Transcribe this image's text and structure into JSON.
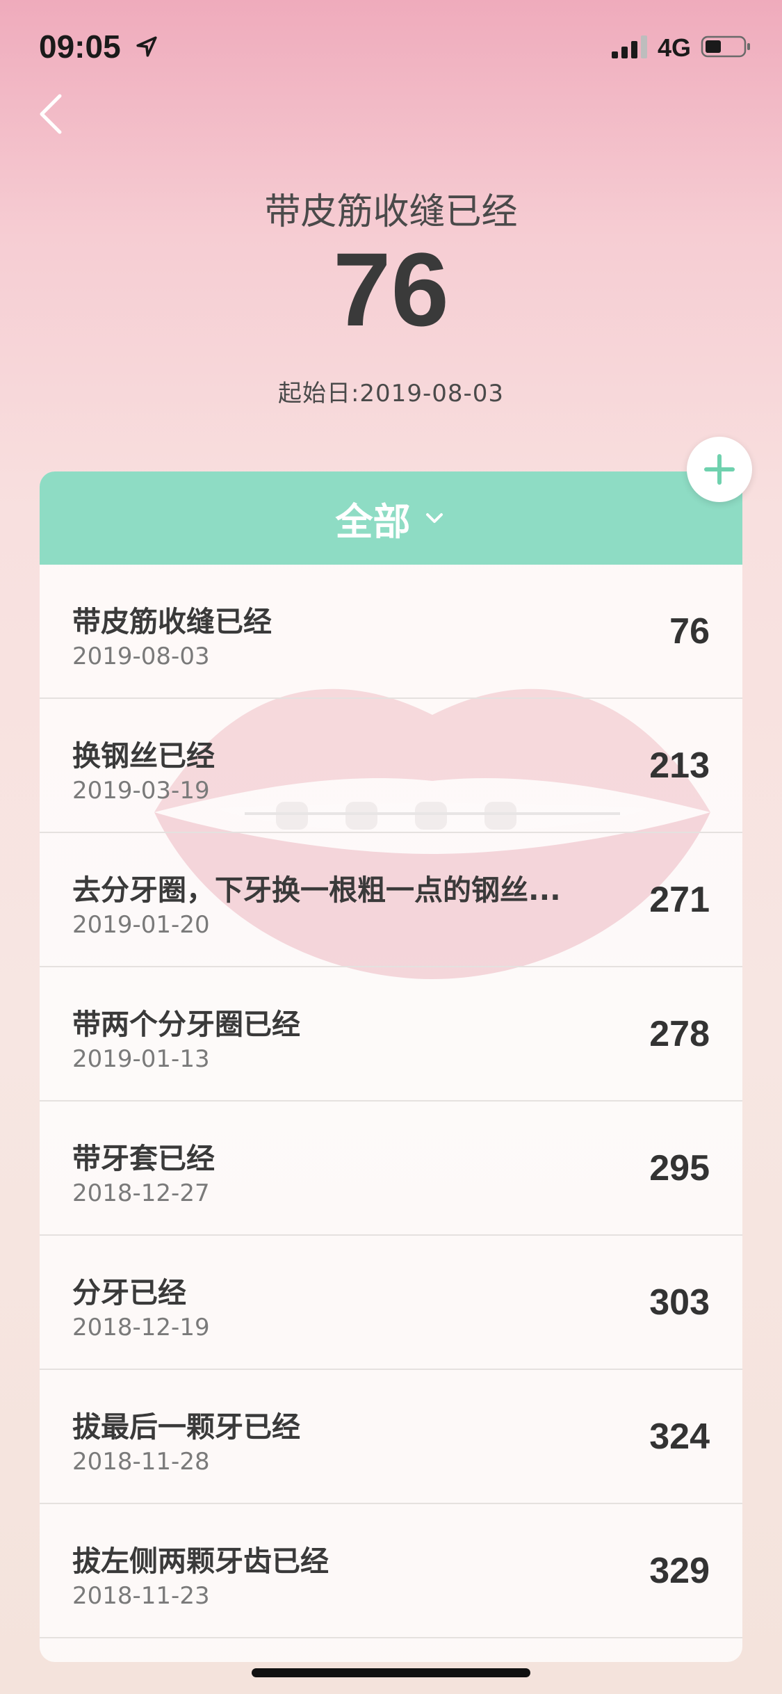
{
  "status_bar": {
    "time": "09:05",
    "network": "4G"
  },
  "header": {
    "title": "带皮筋收缝已经",
    "count": "76",
    "start_date": "起始日:2019-08-03"
  },
  "filter": {
    "label": "全部"
  },
  "colors": {
    "accent": "#8edcc4",
    "add_icon": "#6fd1ae"
  },
  "icons": {
    "back": "chevron-left-icon",
    "add": "plus-icon",
    "filter": "chevron-down-icon",
    "location": "location-arrow-icon",
    "signal": "signal-icon",
    "battery": "battery-icon"
  },
  "items": [
    {
      "title": "带皮筋收缝已经",
      "date": "2019-08-03",
      "count": "76"
    },
    {
      "title": "换钢丝已经",
      "date": "2019-03-19",
      "count": "213"
    },
    {
      "title": "去分牙圈，下牙换一根粗一点的钢丝...",
      "date": "2019-01-20",
      "count": "271"
    },
    {
      "title": "带两个分牙圈已经",
      "date": "2019-01-13",
      "count": "278"
    },
    {
      "title": "带牙套已经",
      "date": "2018-12-27",
      "count": "295"
    },
    {
      "title": "分牙已经",
      "date": "2018-12-19",
      "count": "303"
    },
    {
      "title": "拔最后一颗牙已经",
      "date": "2018-11-28",
      "count": "324"
    },
    {
      "title": "拔左侧两颗牙齿已经",
      "date": "2018-11-23",
      "count": "329"
    }
  ]
}
